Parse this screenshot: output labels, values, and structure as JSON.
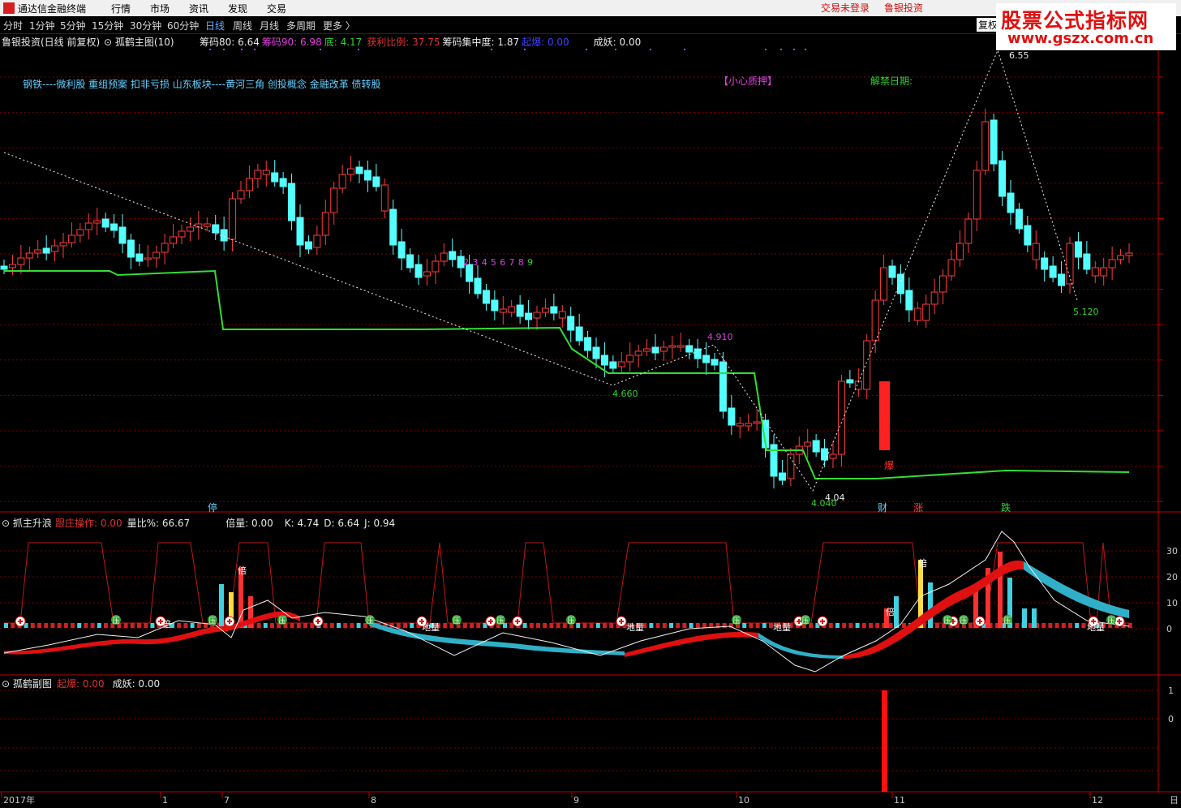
{
  "app": {
    "title": "通达信金融终端",
    "menu": [
      "行情",
      "市场",
      "资讯",
      "发现",
      "交易"
    ],
    "login": "交易未登录",
    "broker": "鲁银投资"
  },
  "periods": [
    "分时",
    "1分钟",
    "5分钟",
    "15分钟",
    "30分钟",
    "60分钟",
    "日线",
    "周线",
    "月线",
    "多周期",
    "更多 〉"
  ],
  "active_period": "日线",
  "fuquan": "复权",
  "watermark": {
    "line1": "股票公式指标网",
    "line2": "www.gszx.com.cn"
  },
  "main": {
    "stock": "鲁银投资(日线 前复权)",
    "indicator": "孤鹤主图(10)",
    "stats": [
      {
        "text": "筹码80: 6.64",
        "color": "#e8e8e8"
      },
      {
        "text": "筹码90: 6.98",
        "color": "#e040e0"
      },
      {
        "text": "底: 4.17",
        "color": "#30d030"
      },
      {
        "text": "获利比例: 37.75",
        "color": "#e03030"
      },
      {
        "text": "筹码集中度: 1.87",
        "color": "#e8e8e8"
      },
      {
        "text": "起爆: 0.00",
        "color": "#4040ff"
      },
      {
        "text": "成妖: 0.00",
        "color": "#e8e8e8"
      }
    ],
    "concepts": "钢铁----微利股 重组预案 扣非亏损 山东板块----黄河三角 创投概念 金融改革 债转股",
    "warning": "【小心质押】",
    "unlock": "解禁日期:",
    "counter": [
      "2",
      "3",
      "4",
      "5",
      "6",
      "7",
      "8",
      "9"
    ],
    "markers": {
      "ting": "停",
      "cai": "财",
      "zhang": "涨",
      "die": "跌",
      "bao": "爆"
    },
    "price_labels": [
      "6.55",
      "4.660",
      "4.910",
      "4.04",
      "4.040",
      "5.120"
    ]
  },
  "sub1": {
    "title": "抓主升浪",
    "stats": [
      {
        "text": "跟庄操作: 0.00",
        "color": "#e03030"
      },
      {
        "text": "量比%: 66.67",
        "color": "#e8e8e8"
      },
      {
        "text": "倍量: 0.00",
        "color": "#e8e8e8"
      },
      {
        "text": "K: 4.74",
        "color": "#e8e8e8"
      },
      {
        "text": "D: 6.64",
        "color": "#e8e8e8"
      },
      {
        "text": "J: 0.94",
        "color": "#e8e8e8"
      }
    ],
    "axis": [
      "30",
      "20",
      "10",
      "0"
    ],
    "tags": {
      "ya": "压",
      "bei": "倍",
      "diliang": "地量"
    }
  },
  "sub2": {
    "title": "孤鹤副图",
    "stats": [
      {
        "text": "起爆: 0.00",
        "color": "#e03030"
      },
      {
        "text": "成妖: 0.00",
        "color": "#e8e8e8"
      }
    ],
    "axis": [
      "1",
      "0"
    ]
  },
  "xaxis": [
    "2017年",
    "1",
    "7",
    "8",
    "9",
    "10",
    "11",
    "12"
  ],
  "xaxis_right": "日",
  "chart_data": {
    "type": "candlestick",
    "title": "鲁银投资(日线 前复权)",
    "annotated_prices": [
      4.04,
      4.66,
      4.91,
      5.12,
      6.55
    ],
    "months": [
      "2017年",
      "1",
      "7",
      "8",
      "9",
      "10",
      "11",
      "12"
    ],
    "sub_indicator_range": [
      0,
      30
    ]
  }
}
